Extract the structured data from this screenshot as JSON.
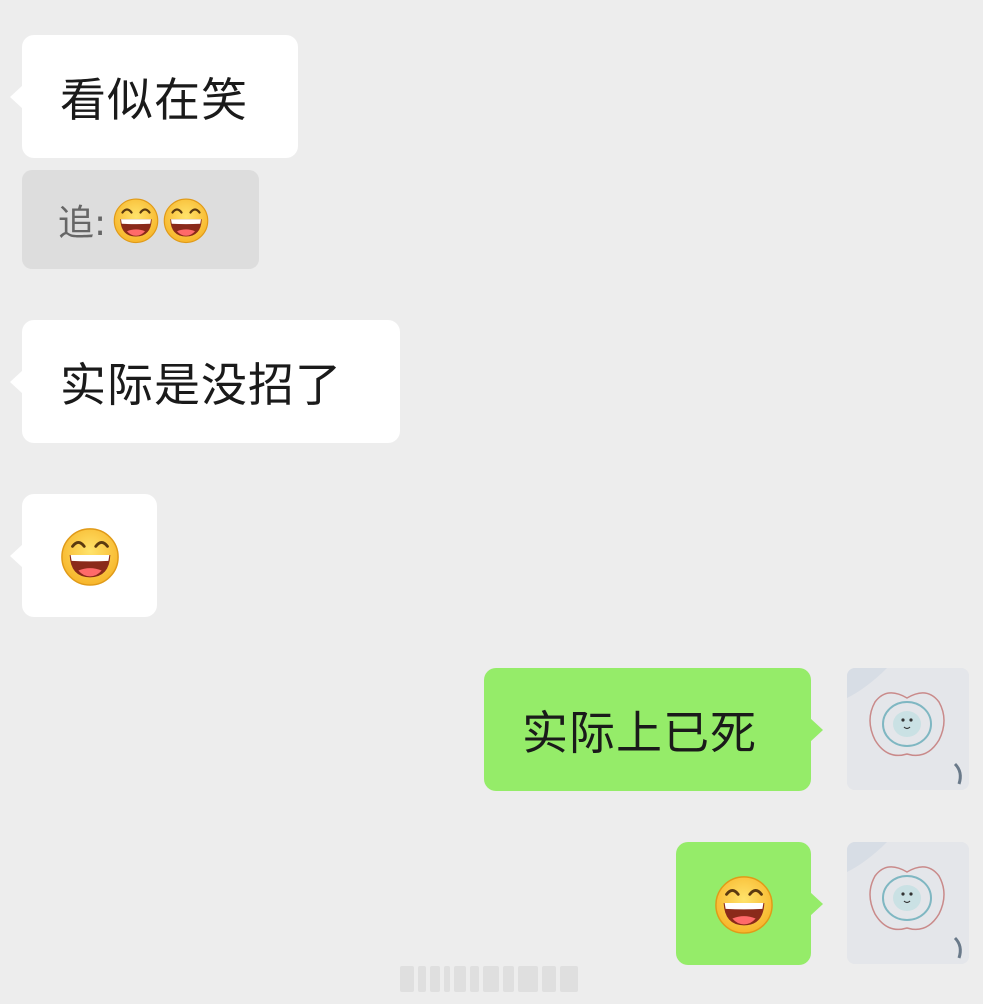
{
  "messages": [
    {
      "side": "in",
      "text": "看似在笑"
    },
    {
      "side": "in",
      "text": "实际是没招了"
    },
    {
      "side": "in",
      "emoji": "grinning-face-emoji"
    },
    {
      "side": "out",
      "text": "实际上已死"
    },
    {
      "side": "out",
      "emoji": "grinning-face-emoji"
    }
  ],
  "reply": {
    "label": "追:",
    "emoji_count": 2,
    "emoji": "grinning-face-emoji"
  },
  "avatar": {
    "icon": "apple-drawing-avatar"
  },
  "colors": {
    "background": "#ededed",
    "incoming_bubble": "#ffffff",
    "outgoing_bubble": "#95ec69",
    "reply_box": "#dddddd"
  }
}
